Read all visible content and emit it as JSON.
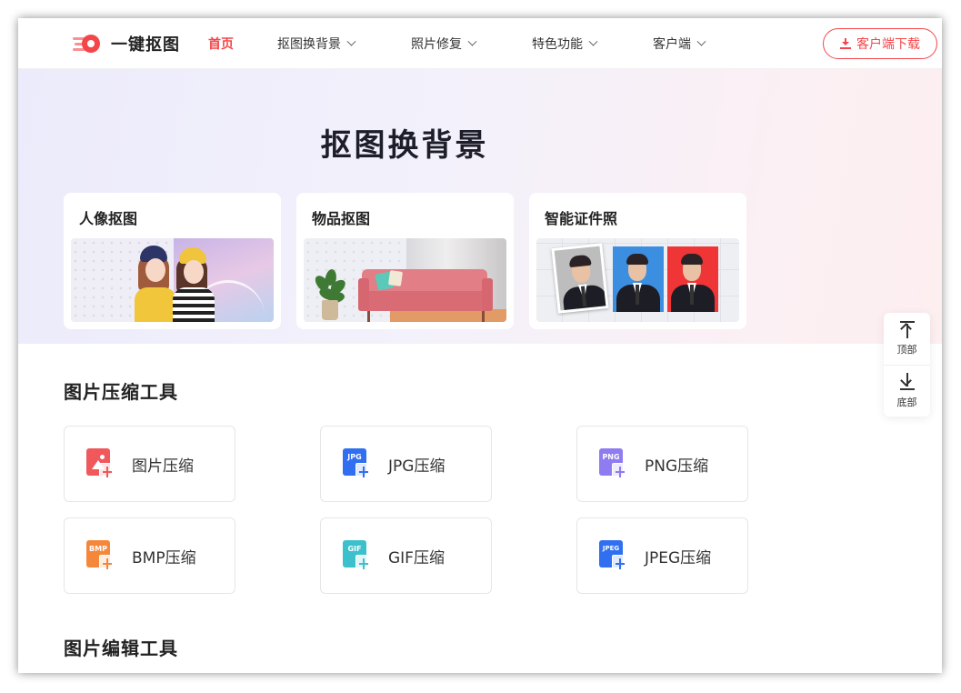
{
  "header": {
    "logo_text": "一键抠图",
    "nav": [
      {
        "label": "首页",
        "active": true
      },
      {
        "label": "抠图换背景"
      },
      {
        "label": "照片修复"
      },
      {
        "label": "特色功能"
      },
      {
        "label": "客户端"
      }
    ],
    "download_label": "客户端下载"
  },
  "hero": {
    "title": "抠图换背景",
    "cards": [
      {
        "title": "人像抠图"
      },
      {
        "title": "物品抠图"
      },
      {
        "title": "智能证件照"
      }
    ]
  },
  "compress_section": {
    "title": "图片压缩工具",
    "tools": [
      {
        "label": "图片压缩",
        "icon": "image-compress-icon",
        "color": "#f0585c"
      },
      {
        "label": "JPG压缩",
        "icon": "jpg-file-icon",
        "badge": "JPG",
        "color": "#2f6ff0"
      },
      {
        "label": "PNG压缩",
        "icon": "png-file-icon",
        "badge": "PNG",
        "color": "#8f7cf0"
      },
      {
        "label": "BMP压缩",
        "icon": "bmp-file-icon",
        "badge": "BMP",
        "color": "#f5873a"
      },
      {
        "label": "GIF压缩",
        "icon": "gif-file-icon",
        "badge": "GIF",
        "color": "#3cc0cc"
      },
      {
        "label": "JPEG压缩",
        "icon": "jpeg-file-icon",
        "badge": "JPEG",
        "color": "#2f6ff0"
      }
    ]
  },
  "edit_section": {
    "title": "图片编辑工具"
  },
  "side_widget": {
    "top_label": "顶部",
    "bottom_label": "底部"
  },
  "colors": {
    "accent": "#f4464a"
  }
}
